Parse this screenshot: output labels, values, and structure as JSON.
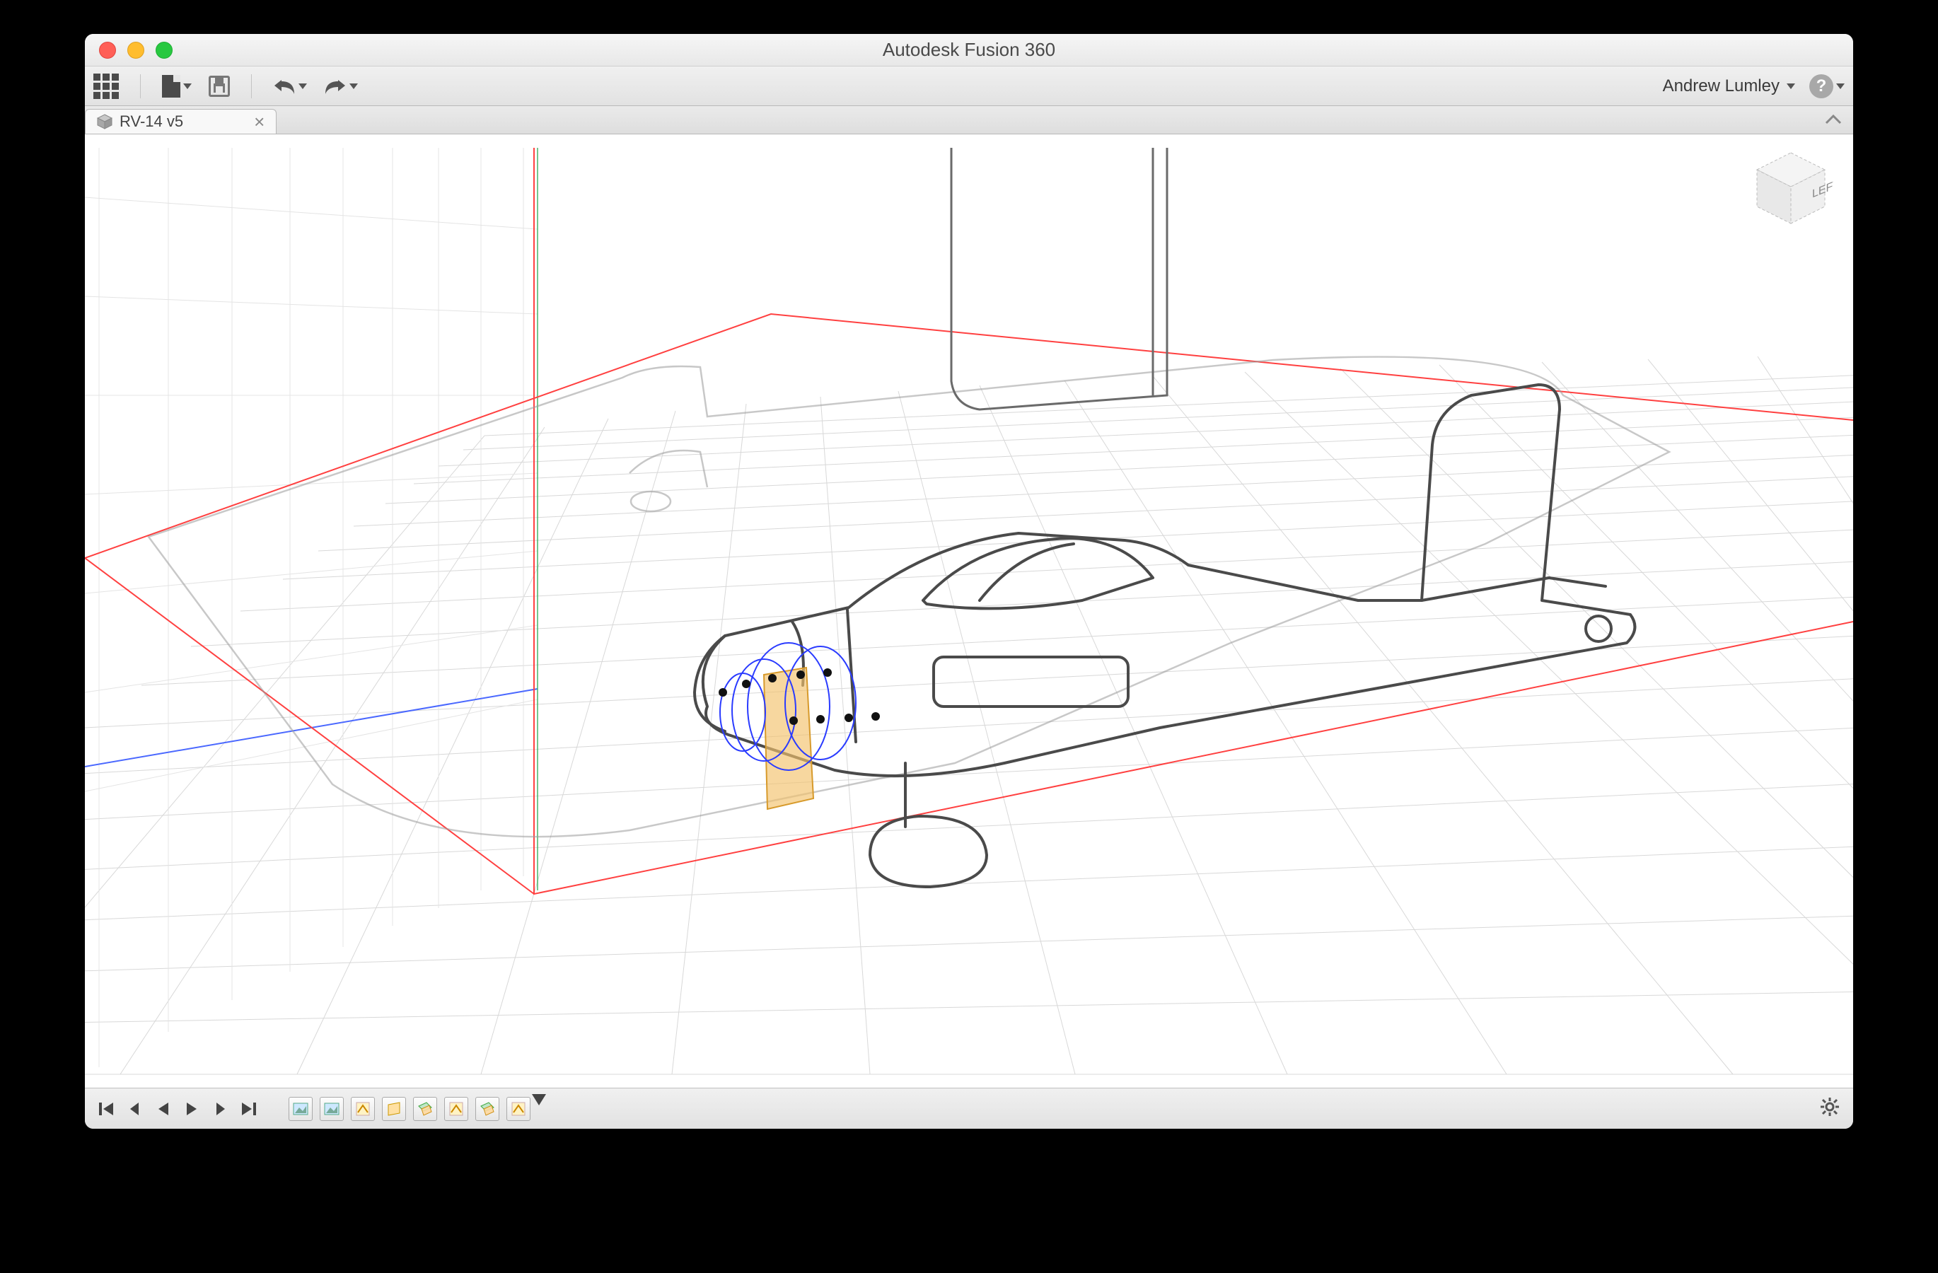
{
  "window": {
    "title": "Autodesk Fusion 360"
  },
  "user": {
    "name": "Andrew Lumley"
  },
  "tabs": [
    {
      "label": "RV-14 v5"
    }
  ],
  "viewcube": {
    "face": "LEFT"
  },
  "toolbar": {
    "grid_tip": "Data Panel",
    "file_tip": "File",
    "save_tip": "Save",
    "undo_tip": "Undo",
    "redo_tip": "Redo",
    "help_tip": "Help"
  },
  "timeline": {
    "controls": {
      "first": "Go to start",
      "step_back": "Step back",
      "play_back": "Play reverse",
      "play": "Play",
      "step_fwd": "Step forward",
      "last": "Go to end"
    },
    "features": [
      "canvas-1",
      "canvas-2",
      "sketch-1",
      "sketch-2",
      "plane-1",
      "sketch-3",
      "plane-2",
      "sketch-4"
    ],
    "settings_tip": "Timeline settings"
  }
}
